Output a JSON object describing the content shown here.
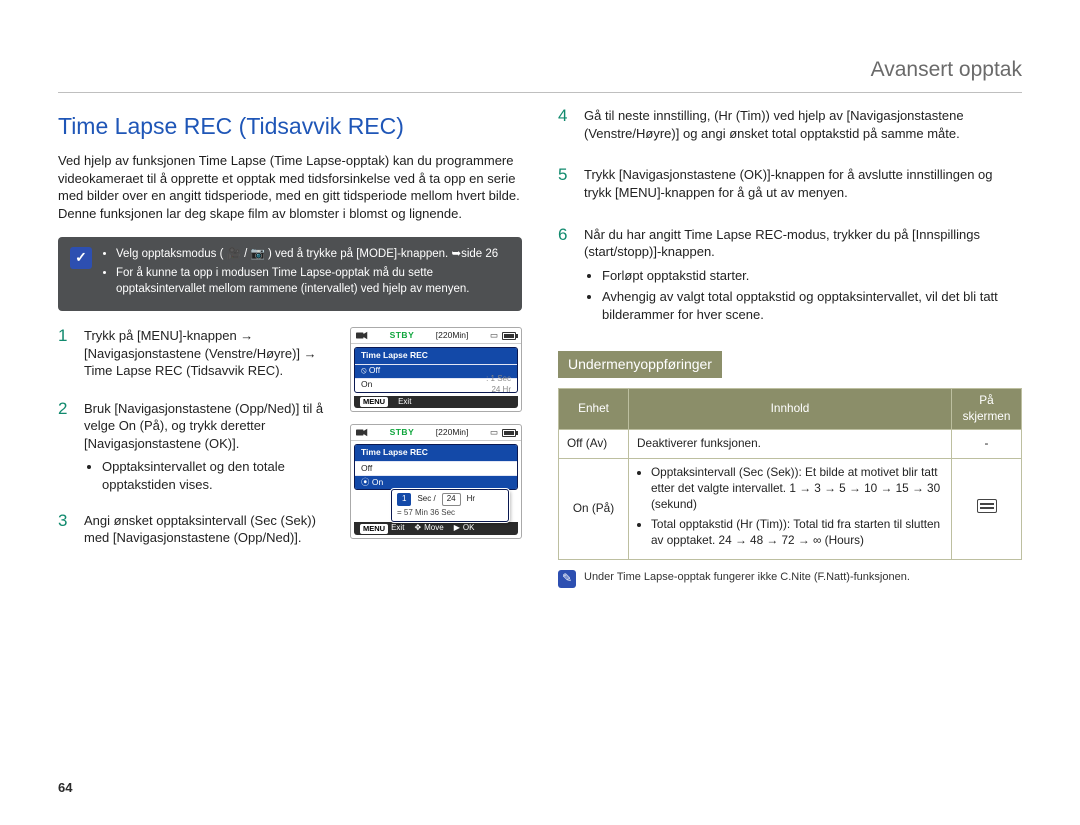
{
  "header": {
    "title": "Avansert opptak"
  },
  "left": {
    "heading": "Time Lapse REC (Tidsavvik REC)",
    "intro": "Ved hjelp av funksjonen Time Lapse (Time Lapse-opptak) kan du programmere videokameraet til å opprette et opptak med tidsforsinkelse ved å ta opp en serie med bilder over en angitt tidsperiode, med en gitt tidsperiode mellom hvert bilde. Denne funksjonen lar deg skape film av blomster i blomst og lignende.",
    "note": {
      "items": [
        "Velg opptaksmodus ( 🎥 / 📷 ) ved å trykke på [MODE]-knappen. ➥side 26",
        "For å kunne ta opp i modusen Time Lapse-opptak må du sette opptaksintervallet mellom rammene (intervallet) ved hjelp av menyen."
      ]
    },
    "steps": {
      "1": "Trykk på [MENU]-knappen → [Navigasjonstastene (Venstre/Høyre)] → Time Lapse REC (Tidsavvik REC).",
      "2": "Bruk [Navigasjonstastene (Opp/Ned)] til å velge On (På), og trykk deretter [Navigasjonstastene (OK)].",
      "2b": "Opptaksintervallet og den totale opptakstiden vises.",
      "3": "Angi ønsket opptaksintervall (Sec (Sek)) med [Navigasjonstastene (Opp/Ned)]."
    },
    "lcd1": {
      "stby": "STBY",
      "time": "[220Min]",
      "menu_title": "Time Lapse REC",
      "row_off": "Off",
      "row_on": "On",
      "row_on_val1": ": 1 Sec",
      "row_on_val2": "24 Hr",
      "exit": "Exit",
      "menu_tag": "MENU"
    },
    "lcd2": {
      "stby": "STBY",
      "time": "[220Min]",
      "menu_title": "Time Lapse REC",
      "row_off": "Off",
      "row_on": "On",
      "popup_sec": "1",
      "popup_sec_lbl": "Sec /",
      "popup_hr": "24",
      "popup_hr_lbl": "Hr",
      "popup_eq": "= 57 Min 36 Sec",
      "exit": "Exit",
      "menu_tag": "MENU",
      "move": "Move",
      "ok": "OK"
    }
  },
  "right": {
    "steps": {
      "4": "Gå til neste innstilling, (Hr (Tim)) ved hjelp av [Navigasjonstastene (Venstre/Høyre)] og angi ønsket total opptakstid på samme måte.",
      "5": "Trykk [Navigasjonstastene (OK)]-knappen for å avslutte innstillingen og trykk [MENU]-knappen for å gå ut av menyen.",
      "6": "Når du har angitt Time Lapse REC-modus, trykker du på [Innspillings (start/stopp)]-knappen.",
      "6a": "Forløpt opptakstid starter.",
      "6b": "Avhengig av valgt total opptakstid og opptaksintervallet, vil det bli tatt bilderammer for hver scene."
    },
    "subheading": "Undermenyoppføringer",
    "table": {
      "h1": "Enhet",
      "h2": "Innhold",
      "h3": "På skjermen",
      "r1c1": "Off (Av)",
      "r1c2": "Deaktiverer funksjonen.",
      "r1c3": "-",
      "r2c1": "On (På)",
      "r2b1": "Opptaksintervall (Sec (Sek)): Et bilde at motivet blir tatt etter det valgte intervallet. 1 → 3 → 5 → 10 → 15 → 30 (sekund)",
      "r2b2": "Total opptakstid (Hr (Tim)): Total tid fra starten til slutten av opptaket. 24 → 48 → 72 → ∞ (Hours)"
    },
    "footnote": "Under Time Lapse-opptak fungerer ikke C.Nite (F.Natt)-funksjonen."
  },
  "page_number": "64"
}
